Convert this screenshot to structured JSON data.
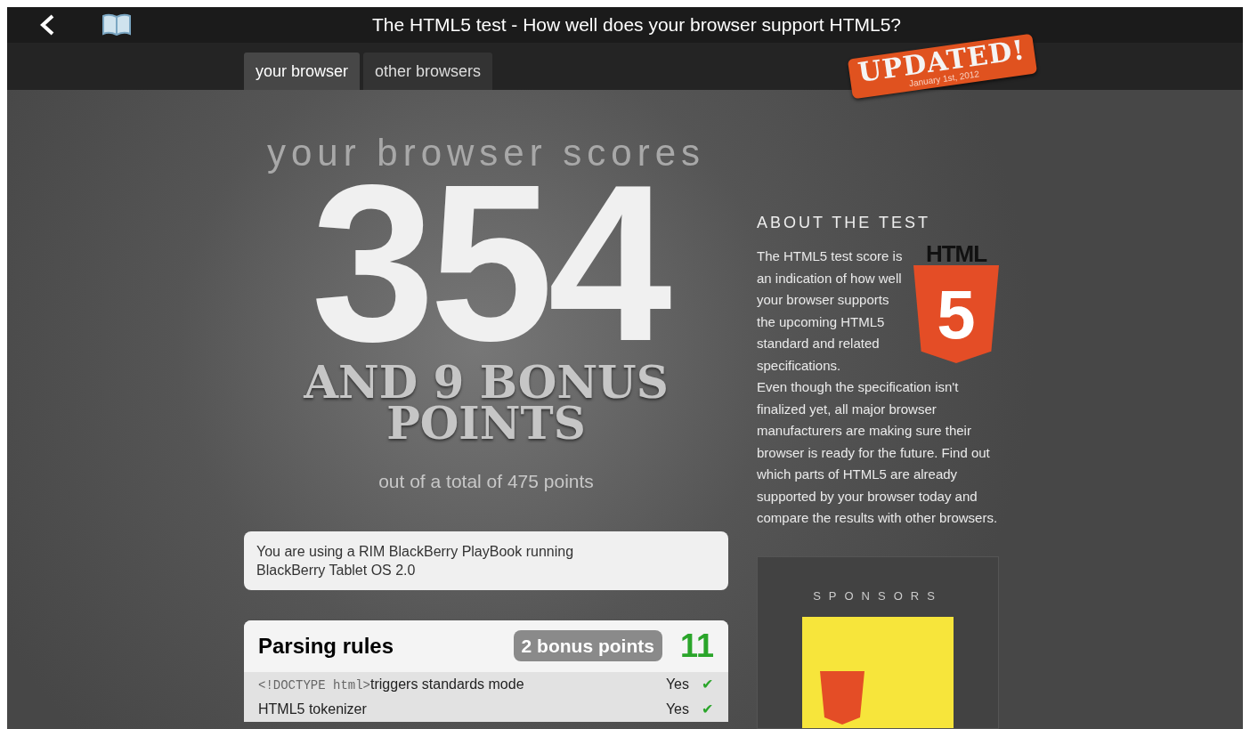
{
  "window": {
    "title": "The HTML5 test - How well does your browser support HTML5?"
  },
  "tabs": [
    {
      "label": "your browser",
      "selected": true
    },
    {
      "label": "other browsers",
      "selected": false
    }
  ],
  "badge": {
    "title": "UPDATED!",
    "date": "January 1st, 2012"
  },
  "score": {
    "heading": "your browser scores",
    "value": "354",
    "bonus": "AND 9 BONUS POINTS",
    "total": "out of a total of 475 points"
  },
  "device": "You are using a RIM BlackBerry PlayBook running BlackBerry Tablet OS 2.0",
  "section": {
    "title": "Parsing rules",
    "bonus": "2 bonus points",
    "score": "11",
    "rows": [
      {
        "code": "<!DOCTYPE html>",
        "label": "triggers standards mode",
        "result": "Yes",
        "passed": true,
        "mark": "✔"
      },
      {
        "code": "",
        "label": "HTML5 tokenizer",
        "result": "Yes",
        "passed": true,
        "mark": "✔"
      }
    ]
  },
  "about": {
    "heading": "ABOUT THE TEST",
    "logo_word": "HTML",
    "logo_digit": "5",
    "text": "The HTML5 test score is an indication of how well your browser supports the upcoming HTML5 standard and related specifications.",
    "text_more": "Even though the specification isn't finalized yet, all major browser manufacturers are making sure their browser is ready for the future. Find out which parts of HTML5 are already supported by your browser today and compare the results with other browsers."
  },
  "sponsors": {
    "heading": "SPONSORS"
  }
}
